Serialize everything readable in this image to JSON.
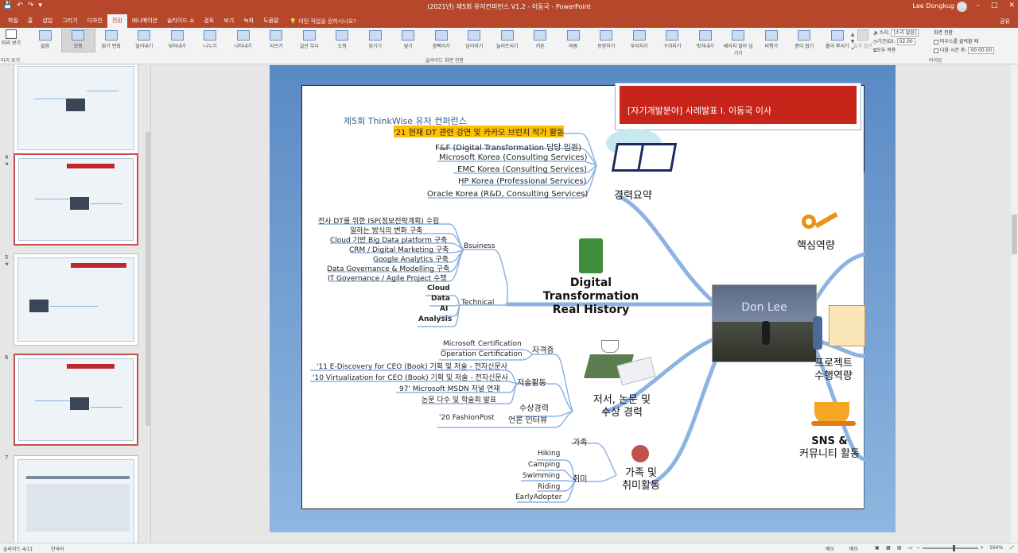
{
  "titlebar": {
    "title": "(2021년) 제5회 유저컨퍼런스 V1.2 - 이동국 - PowerPoint",
    "user": "Lee Dongkug",
    "qat": [
      "💾",
      "↶",
      "↷",
      "▾"
    ]
  },
  "tabs": [
    "파일",
    "홈",
    "삽입",
    "그리기",
    "디자인",
    "전환",
    "애니메이션",
    "슬라이드 쇼",
    "검토",
    "보기",
    "녹화",
    "도움말"
  ],
  "active_tab": "전환",
  "tellme": "어떤 작업을 원하시나요?",
  "share": "공유",
  "ribbon": {
    "preview": "미리 보기",
    "gallery": [
      "없음",
      "모핑",
      "밝기 변화",
      "밀어내기",
      "닦아내기",
      "나누기",
      "나타내기",
      "자르기",
      "실선 무늬",
      "도형",
      "당기기",
      "덮기",
      "깜빡이기",
      "넘어지기",
      "늘어뜨리기",
      "커튼",
      "바람",
      "등장하기",
      "부서지기",
      "구겨지기",
      "벗겨내기",
      "페이지 말아 넘기기",
      "비행기",
      "종이 접기",
      "흩어 뿌리기"
    ],
    "selected": "모핑",
    "effect_options": "효과 옵션",
    "sound_label": "소리:",
    "sound_value": "[소리 없음]",
    "duration_label": "기간(D):",
    "duration_value": "02.00",
    "apply_all": "모두 적용",
    "advance_title": "화면 전환",
    "on_click": "마우스를 클릭할 때",
    "after_label": "다음 시간 후:",
    "after_value": "00:00.00",
    "groups": {
      "preview": "미리 보기",
      "transitions": "슬라이드 화면 전환",
      "timing": "타이밍"
    }
  },
  "thumbs": [
    {
      "num": "4",
      "star": "★"
    },
    {
      "num": "5",
      "star": "★"
    },
    {
      "num": "6",
      "star": ""
    },
    {
      "num": "7",
      "star": ""
    }
  ],
  "slide": {
    "header_box": "[자기개발분야]  사례발표 I.  이동국 이사",
    "title": "제5회 ThinkWise 유저 컨퍼런스",
    "center": "Don Lee",
    "main_topic": [
      "Digital Transformation",
      "Real History"
    ],
    "career": {
      "label": "경력요약",
      "items": [
        "'21 현재 DT 관련 강연 및 카카오 브런치 작가 활동",
        "F&F (Digital Transformation 담당 임원)",
        "Microsoft Korea (Consulting Services)",
        "EMC Korea (Consulting Services)",
        "HP Korea (Professional Services)",
        "Oracle Korea (R&D, Consulting Services)"
      ]
    },
    "bsuiness": {
      "label": "Bsuiness",
      "items": [
        "전사 DT를 위한 ISP(정보전략계획) 수립",
        "일하는 방식의 변화 구축",
        "Cloud 기반 Big Data platform 구축",
        "CRM / Digital Marketing 구축",
        "Google Analytics 구축",
        "Data Governance & Modelling 구축",
        "IT Governance / Agile Project 수행"
      ]
    },
    "technical": {
      "label": "Technical",
      "items": [
        "Cloud",
        "Data",
        "AI",
        "Analysis"
      ]
    },
    "books": {
      "label": [
        "저서, 논문 및",
        "수상 경력"
      ],
      "cert_label": "자격증",
      "cert": [
        "Microsoft Certification",
        "Operation Certification"
      ],
      "writing_label": "저술활동",
      "writing": [
        "'11 E-Discovery for CEO (Book) 기획 및 저술 - 전자신문사",
        "'10 Virtualization for CEO (Book) 기획 및 저술 - 전자신문사",
        "97' Microsoft MSDN 저널 연재",
        "논문 다수 및 학술회 발표"
      ],
      "award": "수상경력",
      "interview_label": "언론 인터뷰",
      "interview": "'20 FashionPost"
    },
    "family": {
      "label": [
        "가족 및",
        "취미활동"
      ],
      "family_label": "가족",
      "hobby_label": "취미",
      "hobbies": [
        "Hiking",
        "Camping",
        "Swimming",
        "Riding",
        "EarlyAdopter"
      ]
    },
    "right": {
      "core": "핵심역량",
      "project": [
        "프로젝트",
        "수행역량"
      ],
      "sns": [
        "SNS &",
        "커뮤니티 활동"
      ]
    }
  },
  "status": {
    "slide": "슬라이드 4/11",
    "lang": "한국어",
    "notes": "메모",
    "comments": "메모",
    "zoom": "164%"
  }
}
